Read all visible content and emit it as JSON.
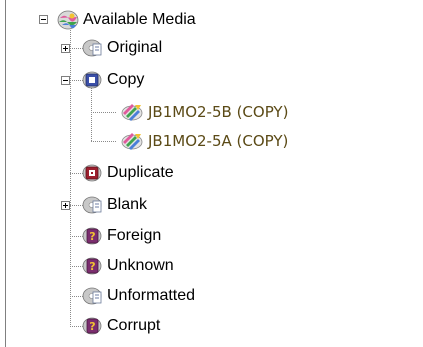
{
  "tree": {
    "root": {
      "label": "Available Media",
      "icon": "media-pool-icon",
      "expanded": true
    },
    "nodes": [
      {
        "key": "original",
        "label": "Original",
        "icon": "media-group-icon",
        "expander": "collapsed"
      },
      {
        "key": "copy",
        "label": "Copy",
        "icon": "copy-media-icon",
        "expander": "expanded",
        "children": [
          {
            "key": "jb1mo2-5b",
            "label": "JB1MO2-5B (COPY)",
            "icon": "disc-volume-icon"
          },
          {
            "key": "jb1mo2-5a",
            "label": "JB1MO2-5A (COPY)",
            "icon": "disc-volume-icon"
          }
        ]
      },
      {
        "key": "duplicate",
        "label": "Duplicate",
        "icon": "duplicate-media-icon",
        "expander": "none"
      },
      {
        "key": "blank",
        "label": "Blank",
        "icon": "media-group-icon",
        "expander": "collapsed"
      },
      {
        "key": "foreign",
        "label": "Foreign",
        "icon": "unknown-media-icon",
        "expander": "none"
      },
      {
        "key": "unknown",
        "label": "Unknown",
        "icon": "unknown-media-icon",
        "expander": "none"
      },
      {
        "key": "unformatted",
        "label": "Unformatted",
        "icon": "media-group-icon",
        "expander": "none"
      },
      {
        "key": "corrupt",
        "label": "Corrupt",
        "icon": "unknown-media-icon",
        "expander": "none"
      }
    ]
  },
  "colors": {
    "volume_text": "#5b4a16",
    "connector": "#8a8a8a",
    "panel_border": "#808080"
  }
}
